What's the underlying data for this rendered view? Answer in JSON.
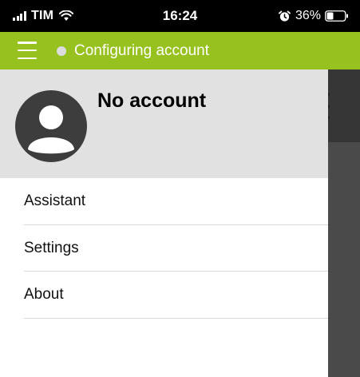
{
  "status_bar": {
    "carrier": "TIM",
    "time": "16:24",
    "battery_percent": "36%",
    "icons": [
      "signal-icon",
      "wifi-icon",
      "alarm-icon",
      "battery-icon"
    ]
  },
  "app_bar": {
    "title": "Configuring account",
    "accent_color": "#97c11f",
    "status_dot_color": "#dcdcdc",
    "icons": [
      "menu-icon"
    ]
  },
  "drawer": {
    "account_name": "No account",
    "header_color": "#e1e1e1",
    "avatar_icon": "user-avatar-icon",
    "items": [
      {
        "label": "Assistant"
      },
      {
        "label": "Settings"
      },
      {
        "label": "About"
      }
    ]
  }
}
